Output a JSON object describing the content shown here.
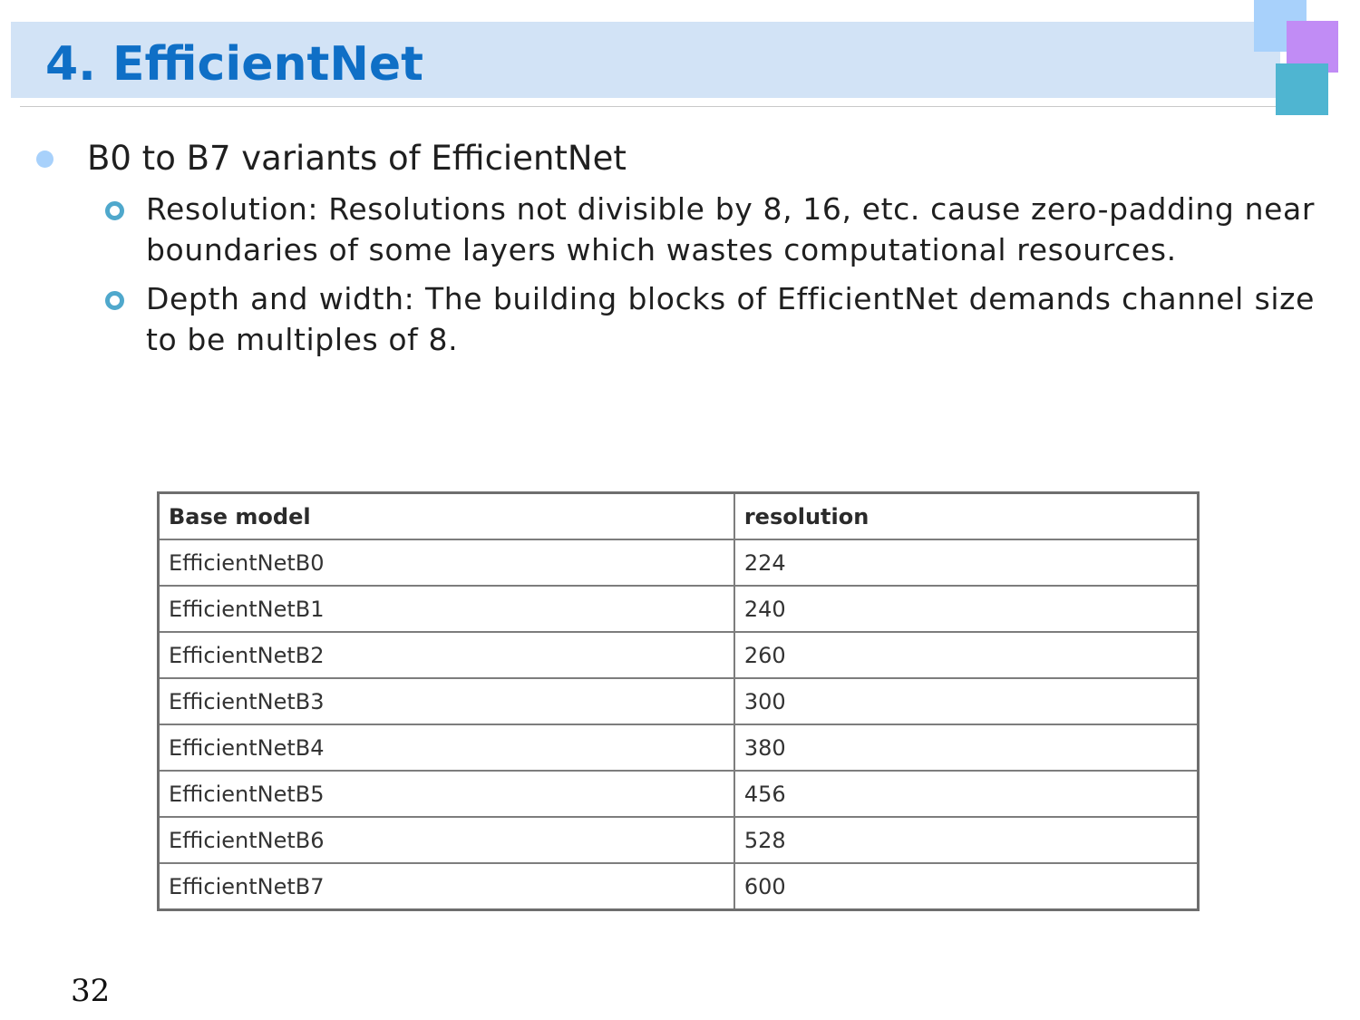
{
  "slide": {
    "title": "4. EfficientNet",
    "page_number": "32"
  },
  "colors": {
    "title_band": "#d2e3f6",
    "title_text": "#0f6fc6",
    "square_blue": "#a8d1fb",
    "square_violet": "#c18cf5",
    "square_teal": "#4fb5d1",
    "bullet_dot": "#a8d1fb",
    "sub_bullet_ring": "#4fa8cc"
  },
  "bullets": {
    "main": "B0 to B7 variants of EfficientNet",
    "sub": [
      "Resolution: Resolutions not divisible by 8, 16, etc. cause zero-padding near boundaries of some layers which wastes computational resources.",
      "Depth and width: The building blocks of EfficientNet demands channel size to be multiples of 8."
    ]
  },
  "table": {
    "headers": [
      "Base model",
      "resolution"
    ],
    "rows": [
      [
        "EfficientNetB0",
        "224"
      ],
      [
        "EfficientNetB1",
        "240"
      ],
      [
        "EfficientNetB2",
        "260"
      ],
      [
        "EfficientNetB3",
        "300"
      ],
      [
        "EfficientNetB4",
        "380"
      ],
      [
        "EfficientNetB5",
        "456"
      ],
      [
        "EfficientNetB6",
        "528"
      ],
      [
        "EfficientNetB7",
        "600"
      ]
    ]
  }
}
